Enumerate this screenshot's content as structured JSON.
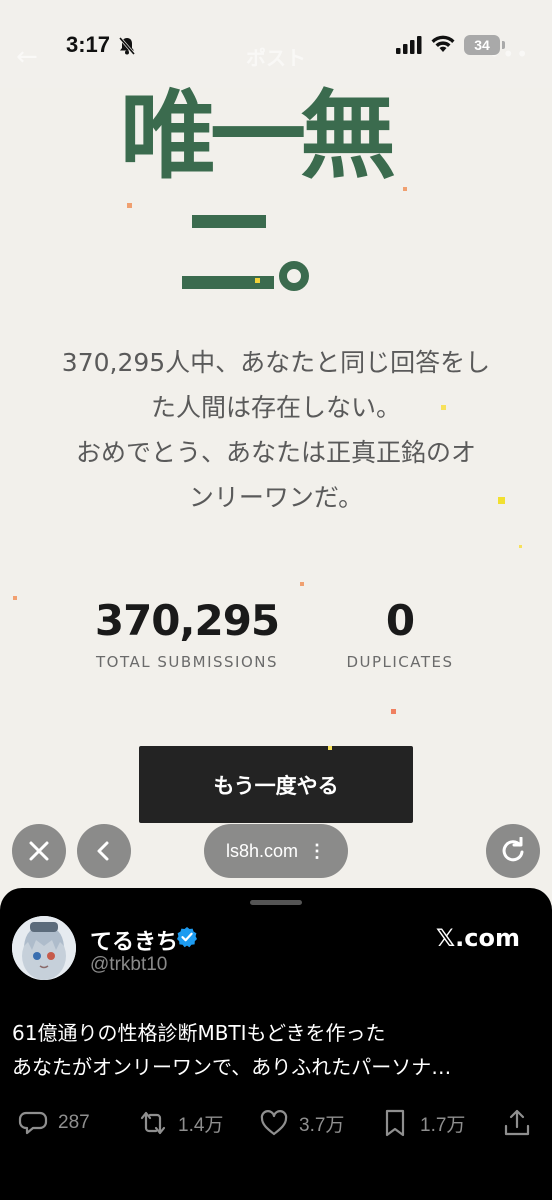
{
  "status_bar": {
    "time": "3:17",
    "battery": "34"
  },
  "ghost_nav": {
    "title": "ポスト",
    "back": "←",
    "more": "•••"
  },
  "result": {
    "headline_line1": "唯一無",
    "message_lines": [
      "370,295人中、あなたと同じ回答をし",
      "た人間は存在しない。",
      "おめでとう、あなたは正真正銘のオ",
      "ンリーワンだ。"
    ],
    "stats": [
      {
        "number": "370,295",
        "label": "TOTAL SUBMISSIONS"
      },
      {
        "number": "0",
        "label": "DUPLICATES"
      }
    ],
    "retry_label": "もう一度やる",
    "colors": {
      "headline": "#3b6b4e",
      "button": "#232323",
      "background": "#f2f0eb"
    }
  },
  "browser": {
    "url": "ls8h.com",
    "close_icon": "close-icon",
    "back_icon": "chevron-left-icon",
    "reload_icon": "reload-icon"
  },
  "post": {
    "author": "てるきち",
    "handle": "@trkbt10",
    "source": "𝕏.com",
    "text_lines": [
      "61億通りの性格診断MBTIもどきを作った",
      "あなたがオンリーワンで、ありふれたパーソナ…"
    ],
    "actions": [
      {
        "icon": "reply-icon",
        "count": "287"
      },
      {
        "icon": "repost-icon",
        "count": "1.4万"
      },
      {
        "icon": "like-icon",
        "count": "3.7万"
      },
      {
        "icon": "bookmark-icon",
        "count": "1.7万"
      },
      {
        "icon": "share-icon",
        "count": ""
      }
    ]
  }
}
